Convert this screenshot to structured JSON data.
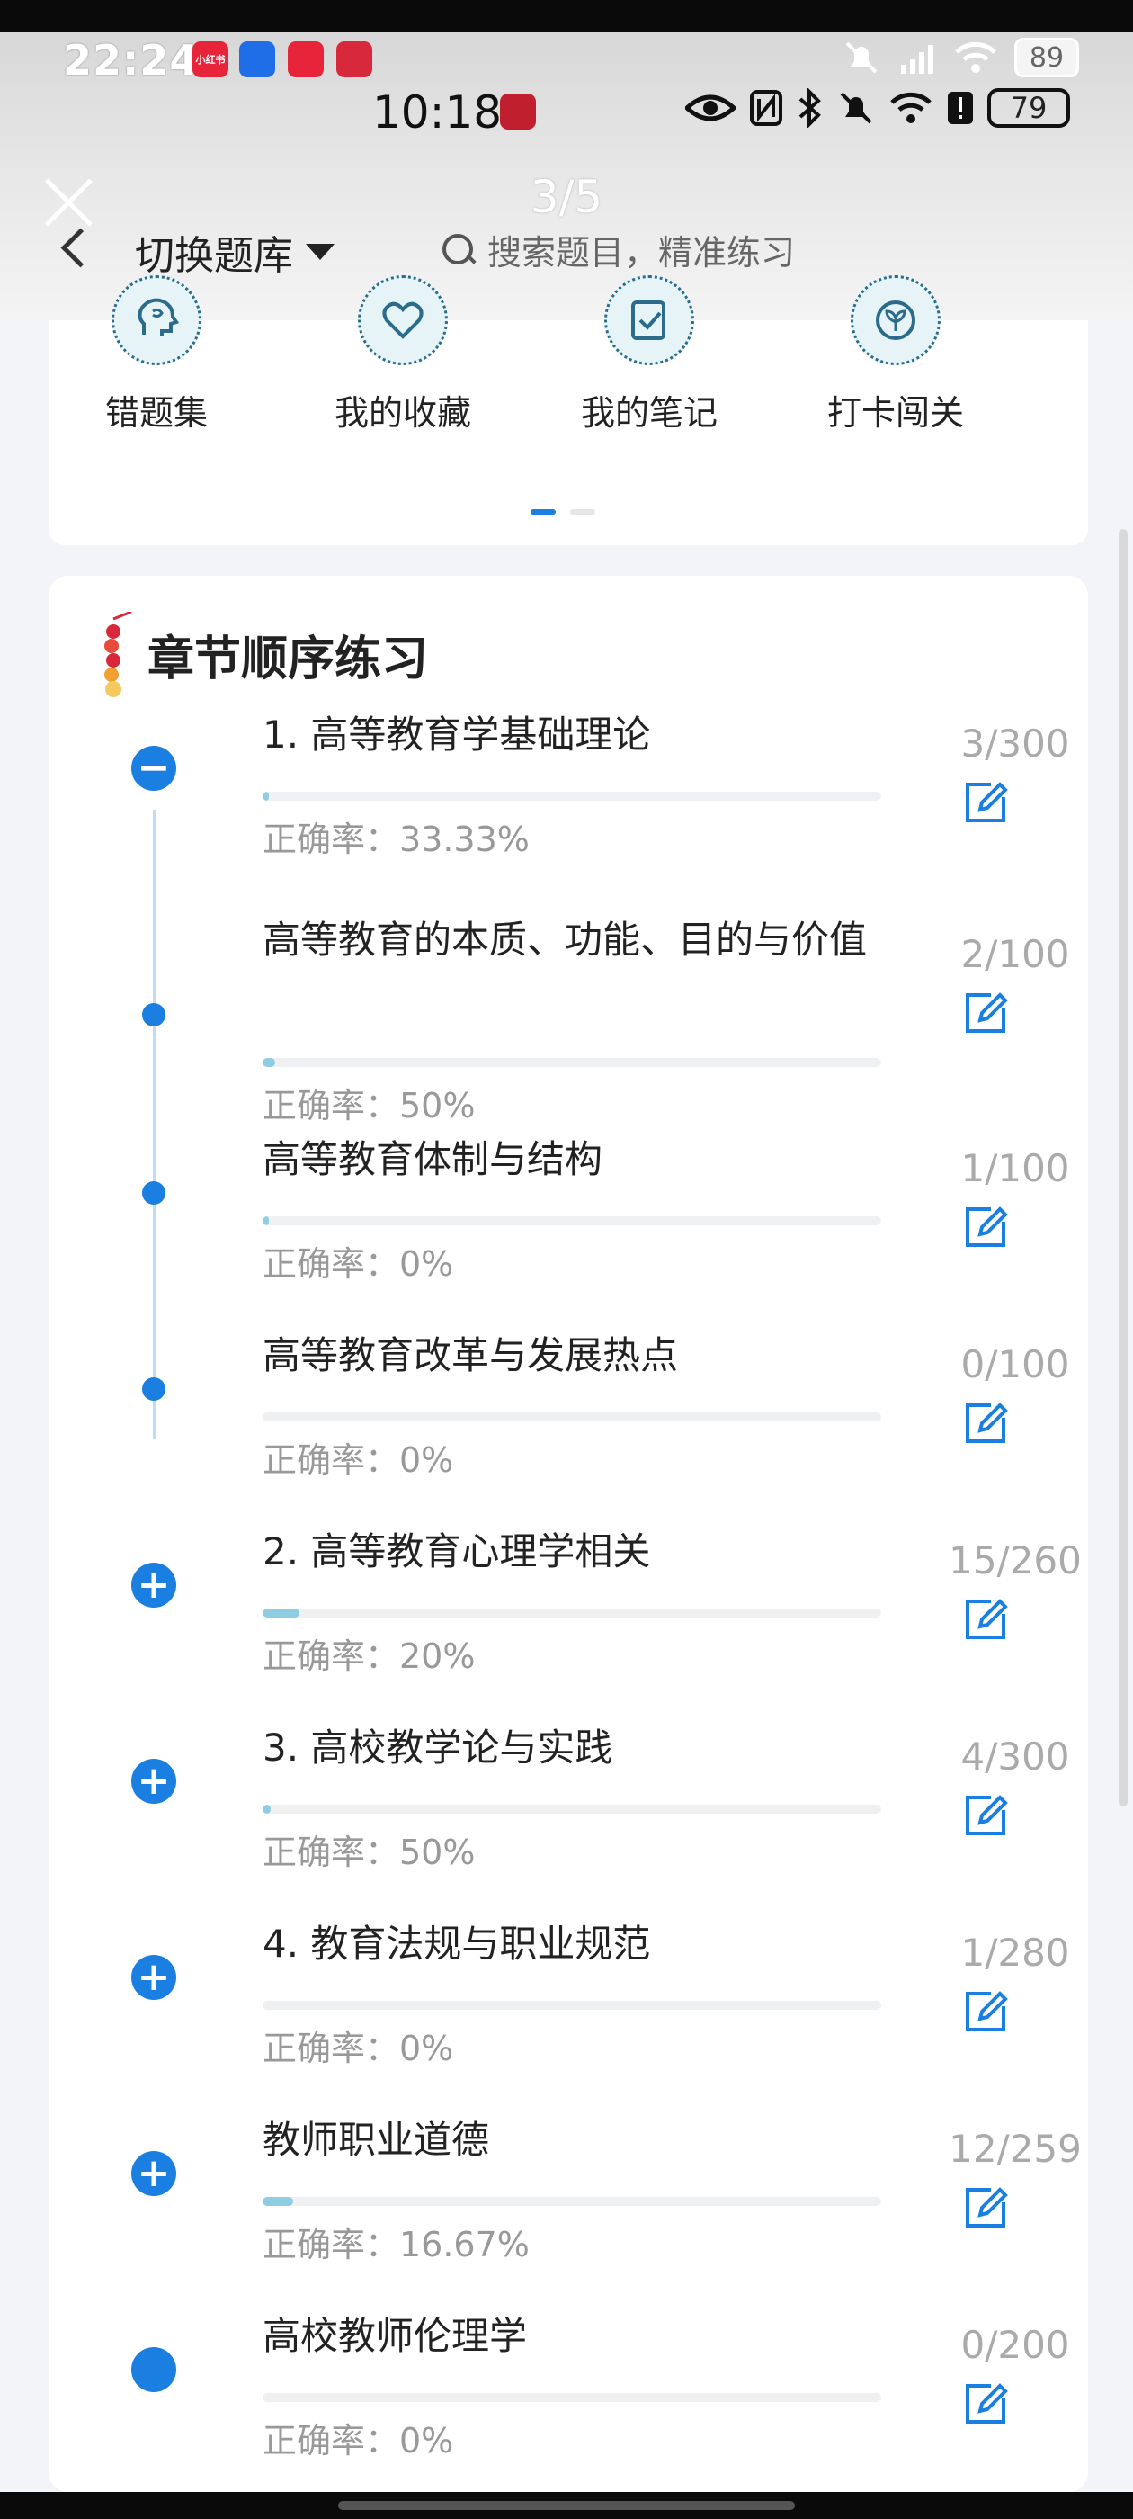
{
  "status_outer": {
    "time": "22:24",
    "battery": "89",
    "badges": [
      "小红书",
      "",
      "",
      ""
    ]
  },
  "status_inner": {
    "time": "10:18",
    "battery": "79"
  },
  "viewer": {
    "counter": "3/5"
  },
  "header": {
    "switch_label": "切换题库",
    "search_placeholder": "搜索题目，精准练习"
  },
  "shortcuts": [
    {
      "label": "错题集",
      "icon": "head-icon"
    },
    {
      "label": "我的收藏",
      "icon": "heart-icon"
    },
    {
      "label": "我的笔记",
      "icon": "note-icon"
    },
    {
      "label": "打卡闯关",
      "icon": "leaf-icon"
    }
  ],
  "chapter": {
    "title": "章节顺序练习",
    "items": [
      {
        "title": "1. 高等教育学基础理论",
        "accuracy": "正确率：33.33%",
        "count": "3/300",
        "progress": 0.01,
        "marker": "minus"
      },
      {
        "title": "高等教育的本质、功能、目的与价值",
        "accuracy": "正确率：50%",
        "count": "2/100",
        "progress": 0.02,
        "marker": "dot"
      },
      {
        "title": "高等教育体制与结构",
        "accuracy": "正确率：0%",
        "count": "1/100",
        "progress": 0.01,
        "marker": "dot"
      },
      {
        "title": "高等教育改革与发展热点",
        "accuracy": "正确率：0%",
        "count": "0/100",
        "progress": 0.0,
        "marker": "dot"
      },
      {
        "title": "2. 高等教育心理学相关",
        "accuracy": "正确率：20%",
        "count": "15/260",
        "progress": 0.06,
        "marker": "plus"
      },
      {
        "title": "3. 高校教学论与实践",
        "accuracy": "正确率：50%",
        "count": "4/300",
        "progress": 0.013,
        "marker": "plus"
      },
      {
        "title": "4. 教育法规与职业规范",
        "accuracy": "正确率：0%",
        "count": "1/280",
        "progress": 0.0,
        "marker": "plus"
      },
      {
        "title": "教师职业道德",
        "accuracy": "正确率：16.67%",
        "count": "12/259",
        "progress": 0.05,
        "marker": "plus"
      },
      {
        "title": "高校教师伦理学",
        "accuracy": "正确率：0%",
        "count": "0/200",
        "progress": 0.0,
        "marker": "filled"
      }
    ]
  },
  "colors": {
    "accent": "#1a7fe0",
    "progress": "#8fcde3",
    "muted": "#999999"
  }
}
